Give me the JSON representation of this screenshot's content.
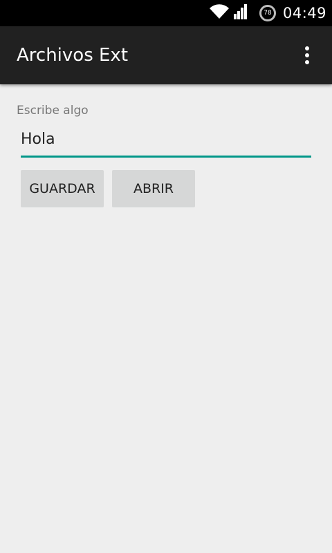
{
  "status_bar": {
    "battery_level": "78",
    "time": "04:49",
    "wifi_icon": "wifi-icon",
    "signal_icon": "cell-signal-icon",
    "battery_icon": "battery-ring-icon"
  },
  "app_bar": {
    "title": "Archivos Ext",
    "menu_icon": "overflow-menu-icon"
  },
  "form": {
    "label": "Escribe algo",
    "input_value": "Hola",
    "accent_color": "#009688"
  },
  "buttons": {
    "save_label": "GUARDAR",
    "open_label": "ABRIR"
  }
}
